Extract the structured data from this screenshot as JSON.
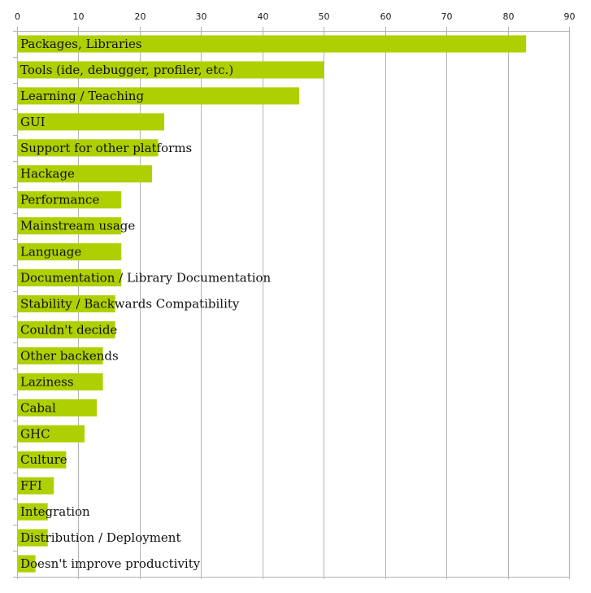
{
  "chart_data": {
    "type": "bar",
    "orientation": "horizontal",
    "title": "",
    "xlabel": "",
    "ylabel": "",
    "xlim": [
      0,
      90
    ],
    "x_ticks": [
      0,
      10,
      20,
      30,
      40,
      50,
      60,
      70,
      80,
      90
    ],
    "x_axis_position": "top",
    "grid": true,
    "legend": "none",
    "bar_color": "#afd000",
    "categories": [
      "Packages, Libraries",
      "Tools (ide, debugger, profiler, etc.)",
      "Learning / Teaching",
      "GUI",
      "Support for other platforms",
      "Hackage",
      "Performance",
      "Mainstream usage",
      "Language",
      "Documentation / Library Documentation",
      "Stability / Backwards Compatibility",
      "Couldn't decide",
      "Other backends",
      "Laziness",
      "Cabal",
      "GHC",
      "Culture",
      "FFI",
      "Integration",
      "Distribution / Deployment",
      "Doesn't improve productivity"
    ],
    "values": [
      83,
      50,
      46,
      24,
      23,
      22,
      17,
      17,
      17,
      17,
      16,
      16,
      14,
      14,
      13,
      11,
      8,
      6,
      5,
      5,
      3
    ]
  }
}
